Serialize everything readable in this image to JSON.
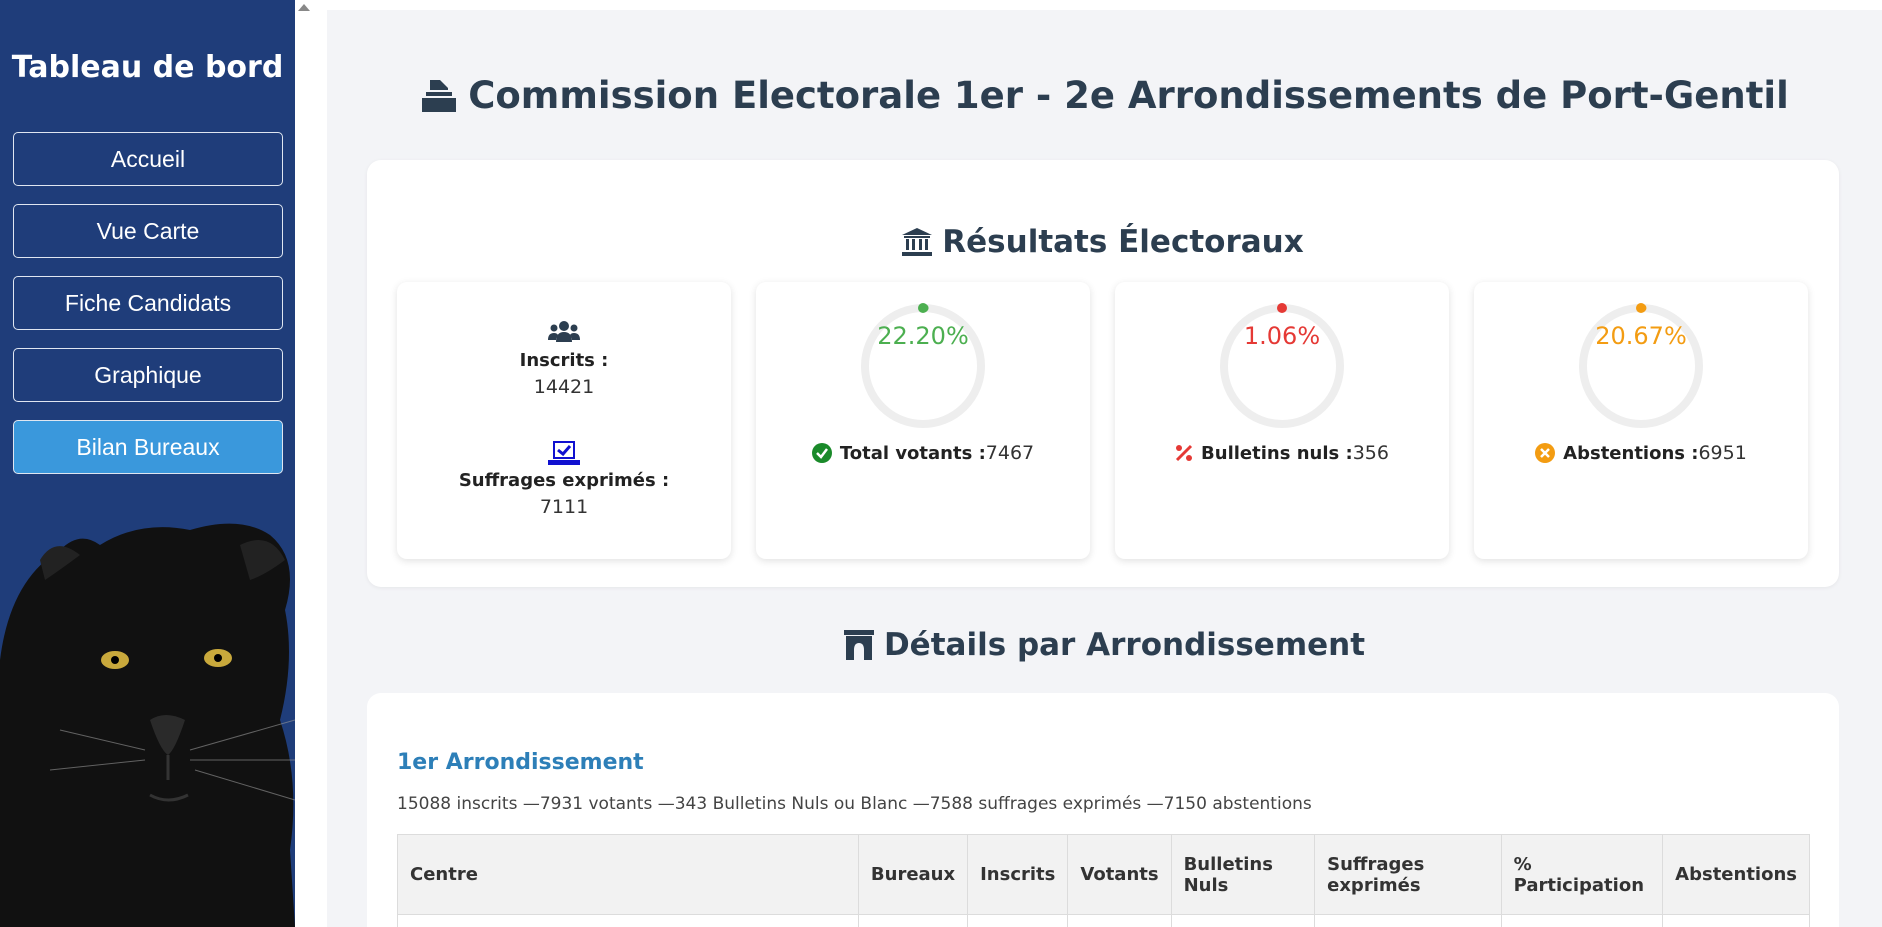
{
  "sidebar": {
    "title": "Tableau de bord",
    "items": [
      {
        "label": "Accueil"
      },
      {
        "label": "Vue Carte"
      },
      {
        "label": "Fiche Candidats"
      },
      {
        "label": "Graphique"
      },
      {
        "label": "Bilan Bureaux"
      }
    ],
    "active_item": "Bilan Bureaux"
  },
  "header": {
    "title": "Commission Electorale 1er - 2e Arrondissements de Port-Gentil",
    "icon": "ballot-box-icon"
  },
  "results": {
    "title": "Résultats Électoraux",
    "icon": "bank-icon",
    "inscrits": {
      "label": "Inscrits :",
      "value": "14421",
      "icon": "users-icon"
    },
    "suffrages": {
      "label": "Suffrages exprimés :",
      "value": "7111",
      "icon": "vote-check-icon"
    },
    "votants": {
      "percent": "22.20%",
      "fraction": 0.222,
      "label": "Total votants :",
      "value": "7467",
      "color": "#4caf50",
      "icon": "check-circle-icon"
    },
    "nuls": {
      "percent": "1.06%",
      "fraction": 0.0106,
      "label": "Bulletins nuls :",
      "value": "356",
      "color": "#e53935",
      "icon": "percent-icon"
    },
    "abstentions": {
      "percent": "20.67%",
      "fraction": 0.2067,
      "label": "Abstentions :",
      "value": "6951",
      "color": "#f39c12",
      "icon": "x-circle-icon"
    }
  },
  "details": {
    "title": "Détails par Arrondissement",
    "icon": "archway-icon",
    "arrondissement": {
      "title": "1er Arrondissement",
      "summary": "15088 inscrits —7931 votants —343 Bulletins Nuls ou Blanc —7588 suffrages exprimés —7150 abstentions"
    },
    "table": {
      "headers": [
        "Centre",
        "Bureaux",
        "Inscrits",
        "Votants",
        "Bulletins Nuls",
        "Suffrages exprimés",
        "% Participation",
        "Abstentions"
      ]
    }
  },
  "colors": {
    "sidebar": "#1f3d7a",
    "active": "#3a98dc",
    "link": "#2d7fb8"
  }
}
